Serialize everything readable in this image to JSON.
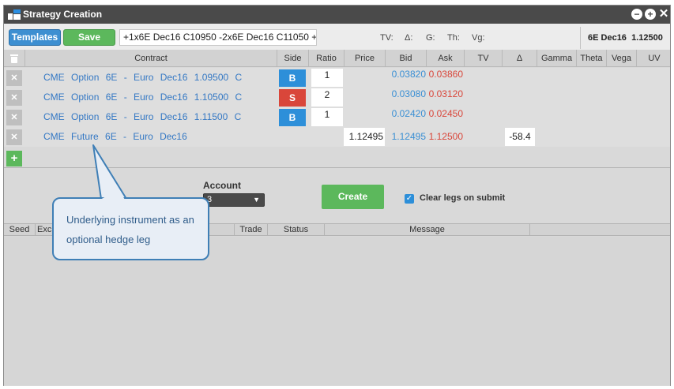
{
  "window": {
    "title": "Strategy Creation"
  },
  "toolbar": {
    "templates_label": "Templates",
    "save_label": "Save",
    "strategy_text": "+1x6E Dec16 C10950 -2x6E Dec16 C11050 +",
    "greeks": [
      "TV:",
      "Δ:",
      "G:",
      "Th:",
      "Vg:"
    ],
    "instrument": "6E Dec16",
    "instrument_price": "1.12500"
  },
  "grid": {
    "columns": [
      "Contract",
      "Side",
      "Ratio",
      "Price",
      "Bid",
      "Ask",
      "TV",
      "Δ",
      "Gamma",
      "Theta",
      "Vega",
      "UV"
    ],
    "rows": [
      {
        "exchange": "CME",
        "type": "Option",
        "product": "6E - Euro",
        "expiry": "Dec16",
        "strike": "1.09500",
        "cp": "C",
        "side": "B",
        "ratio": "1",
        "price": "",
        "bid": "0.03820",
        "ask": "0.03860",
        "delta": ""
      },
      {
        "exchange": "CME",
        "type": "Option",
        "product": "6E - Euro",
        "expiry": "Dec16",
        "strike": "1.10500",
        "cp": "C",
        "side": "S",
        "ratio": "2",
        "price": "",
        "bid": "0.03080",
        "ask": "0.03120",
        "delta": ""
      },
      {
        "exchange": "CME",
        "type": "Option",
        "product": "6E - Euro",
        "expiry": "Dec16",
        "strike": "1.11500",
        "cp": "C",
        "side": "B",
        "ratio": "1",
        "price": "",
        "bid": "0.02420",
        "ask": "0.02450",
        "delta": ""
      },
      {
        "exchange": "CME",
        "type": "Future",
        "product": "6E - Euro",
        "expiry": "Dec16",
        "strike": "",
        "cp": "",
        "side": "",
        "ratio": "",
        "price": "1.12495",
        "bid": "1.12495",
        "ask": "1.12500",
        "delta": "-58.4"
      }
    ],
    "colors": {
      "bid": "#3a8fd4",
      "ask": "#d9463a",
      "buy": "#2d8fd9",
      "sell": "#d9463a",
      "add": "#5cb85c"
    }
  },
  "form": {
    "account_label": "Account",
    "account_value": "3",
    "create_label": "Create",
    "clear_legs_label": "Clear legs on submit",
    "clear_legs_checked": true
  },
  "log": {
    "columns": [
      "Seed",
      "Exch",
      "Trade",
      "Status",
      "Message"
    ]
  },
  "callout": {
    "text": "Underlying instrument as an optional hedge leg"
  }
}
